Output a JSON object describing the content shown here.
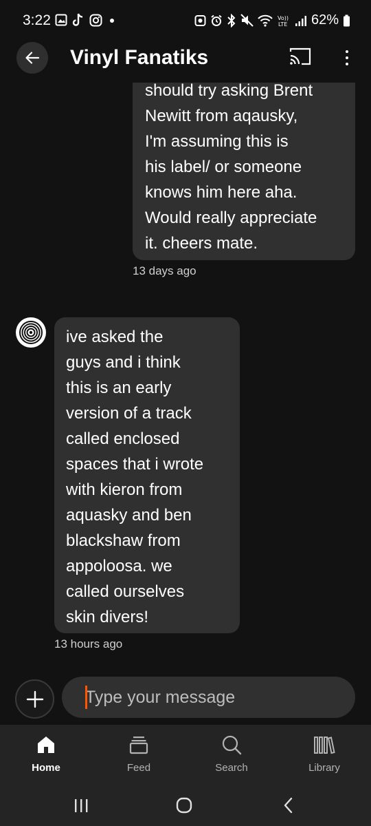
{
  "status": {
    "time": "3:22",
    "battery": "62%",
    "left_icons": [
      "gallery-icon",
      "tiktok-icon",
      "instagram-icon",
      "dot-icon"
    ],
    "right_icons": [
      "alarm-app-icon",
      "alarm-icon",
      "bluetooth-icon",
      "mute-icon",
      "wifi-icon",
      "volte-icon",
      "signal-icon",
      "battery-icon"
    ]
  },
  "header": {
    "title": "Vinyl Fanatiks",
    "back_icon": "arrow-left-icon",
    "cast_icon": "cast-icon",
    "more_icon": "more-vertical-icon"
  },
  "messages": [
    {
      "direction": "outgoing",
      "lines": [
        "should try asking Brent",
        "Newitt from aqausky,",
        "I'm assuming this is",
        "his label/ or someone",
        "knows him here aha.",
        "Would really appreciate",
        "it. cheers mate."
      ],
      "time": "13 days ago"
    },
    {
      "direction": "incoming",
      "lines": [
        "ive asked the",
        "guys and i think",
        "this is an early",
        "version of a track",
        "called enclosed",
        "spaces that i wrote",
        "with kieron from",
        "aquasky and ben",
        "blackshaw from",
        "appoloosa. we",
        "called ourselves",
        "skin divers!"
      ],
      "time": "13 hours ago"
    }
  ],
  "composer": {
    "placeholder": "Type your message",
    "add_icon": "plus-icon",
    "caret_color": "#ff5500"
  },
  "nav": {
    "items": [
      {
        "label": "Home",
        "icon": "home-icon",
        "active": true
      },
      {
        "label": "Feed",
        "icon": "feed-icon",
        "active": false
      },
      {
        "label": "Search",
        "icon": "search-icon",
        "active": false
      },
      {
        "label": "Library",
        "icon": "library-icon",
        "active": false
      }
    ]
  },
  "system_nav": [
    "recents-icon",
    "home-circle-icon",
    "back-chevron-icon"
  ],
  "colors": {
    "background": "#121212",
    "bubble": "#303030",
    "nav_bar": "#242424",
    "accent": "#ff5500"
  }
}
